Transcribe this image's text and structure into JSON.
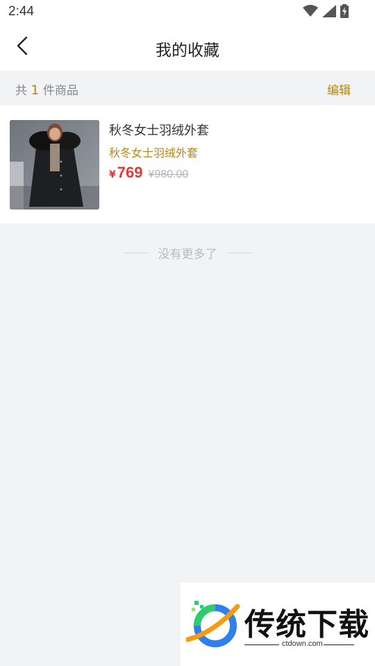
{
  "status_bar": {
    "time": "2:44",
    "icons": [
      "wifi-icon",
      "signal-icon",
      "battery-charging-icon"
    ]
  },
  "header": {
    "title": "我的收藏",
    "back_icon": "chevron-left-icon"
  },
  "count_bar": {
    "prefix": "共",
    "count": "1",
    "suffix": "件商品",
    "edit_label": "编辑"
  },
  "products": [
    {
      "name": "秋冬女士羽绒外套",
      "subtitle": "秋冬女士羽绒外套",
      "price_symbol": "¥",
      "price": "769",
      "original_price": "¥980.00",
      "image": "product-photo-woman-black-down-coat"
    }
  ],
  "footer_note": "没有更多了",
  "watermark": {
    "brand": "传统下载",
    "url": "ctdown.com"
  },
  "colors": {
    "accent": "#b8860b",
    "price": "#e53935",
    "background": "#f2f3f5"
  }
}
